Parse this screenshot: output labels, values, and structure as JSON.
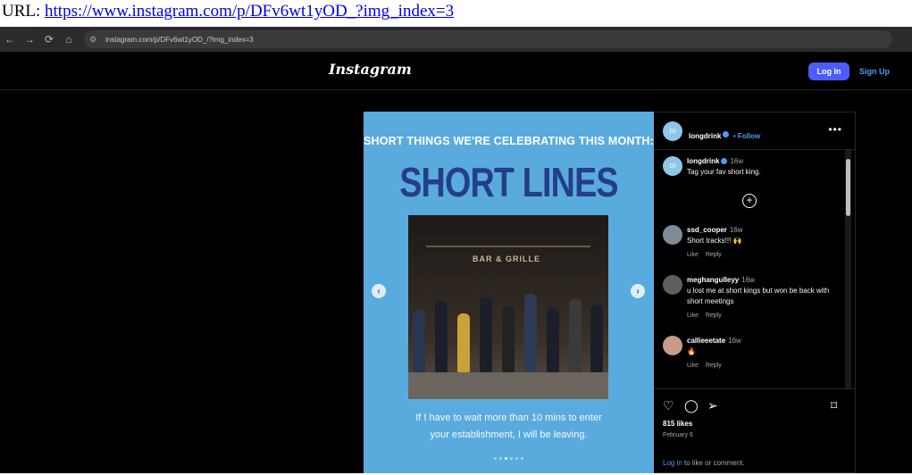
{
  "url_line": {
    "prefix": "URL:",
    "link": "https://www.instagram.com/p/DFv6wt1yOD_?img_index=3"
  },
  "browser": {
    "address": "instagram.com/p/DFv6wt1yOD_/?img_index=3"
  },
  "header": {
    "logo": "Instagram",
    "login_label": "Log In",
    "signup_label": "Sign Up"
  },
  "media": {
    "headline": "SHORT THINGS WE'RE CELEBRATING THIS MONTH:",
    "big_title": "SHORT LINES",
    "photo_sign": "BAR & GRILLE",
    "caption_line1": "If I have to wait more than 10 mins to enter",
    "caption_line2": "your establishment, I will be leaving.",
    "dot_count": 6,
    "active_dot": 3
  },
  "post_header": {
    "username": "longdrink",
    "follow": "• Follow",
    "avatar_text": "DI"
  },
  "caption": {
    "username": "longdrink",
    "time": "16w",
    "text": "Tag your fav short king."
  },
  "comments": [
    {
      "username": "ssd_cooper",
      "time": "16w",
      "text": "Short tracks!!! 🙌",
      "like": "Like",
      "reply": "Reply"
    },
    {
      "username": "meghangulleyy",
      "time": "16w",
      "text": "u lost me at short kings but won be back with short meetings",
      "like": "Like",
      "reply": "Reply"
    },
    {
      "username": "callieeetate",
      "time": "16w",
      "text": "🔥",
      "like": "Like",
      "reply": "Reply"
    }
  ],
  "footer": {
    "likes": "815 likes",
    "date": "February 6",
    "login_link": "Log in",
    "login_rest": " to like or comment."
  },
  "colors": {
    "accent": "#4a5df9",
    "link": "#4a9cf5",
    "media_bg": "#5aabdd",
    "title": "#253e88"
  }
}
